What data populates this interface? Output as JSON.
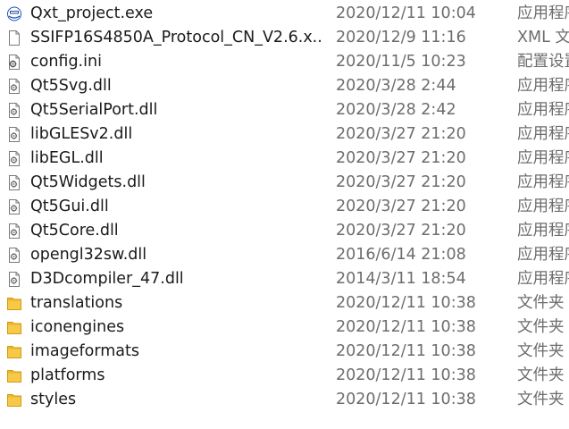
{
  "colors": {
    "text_primary": "#1a1a1a",
    "text_secondary": "#6d6d6d",
    "folder": "#f7c948",
    "hover": "#e5f3ff",
    "exe_brand": "#1f4fb5"
  },
  "files": [
    {
      "name": "Qxt_project.exe",
      "date": "2020/12/11 10:04",
      "type": "应用程序",
      "icon": "exe-icon"
    },
    {
      "name": "SSIFP16S4850A_Protocol_CN_V2.6.x...",
      "date": "2020/12/9 11:16",
      "type": "XML 文档",
      "icon": "xml-file-icon"
    },
    {
      "name": "config.ini",
      "date": "2020/11/5 10:23",
      "type": "配置设置",
      "icon": "ini-file-icon"
    },
    {
      "name": "Qt5Svg.dll",
      "date": "2020/3/28 2:44",
      "type": "应用程序扩展",
      "icon": "dll-file-icon"
    },
    {
      "name": "Qt5SerialPort.dll",
      "date": "2020/3/28 2:42",
      "type": "应用程序扩展",
      "icon": "dll-file-icon"
    },
    {
      "name": "libGLESv2.dll",
      "date": "2020/3/27 21:20",
      "type": "应用程序扩展",
      "icon": "dll-file-icon"
    },
    {
      "name": "libEGL.dll",
      "date": "2020/3/27 21:20",
      "type": "应用程序扩展",
      "icon": "dll-file-icon"
    },
    {
      "name": "Qt5Widgets.dll",
      "date": "2020/3/27 21:20",
      "type": "应用程序扩展",
      "icon": "dll-file-icon"
    },
    {
      "name": "Qt5Gui.dll",
      "date": "2020/3/27 21:20",
      "type": "应用程序扩展",
      "icon": "dll-file-icon"
    },
    {
      "name": "Qt5Core.dll",
      "date": "2020/3/27 21:20",
      "type": "应用程序扩展",
      "icon": "dll-file-icon"
    },
    {
      "name": "opengl32sw.dll",
      "date": "2016/6/14 21:08",
      "type": "应用程序扩展",
      "icon": "dll-file-icon"
    },
    {
      "name": "D3Dcompiler_47.dll",
      "date": "2014/3/11 18:54",
      "type": "应用程序扩展",
      "icon": "dll-file-icon"
    },
    {
      "name": "translations",
      "date": "2020/12/11 10:38",
      "type": "文件夹",
      "icon": "folder-icon"
    },
    {
      "name": "iconengines",
      "date": "2020/12/11 10:38",
      "type": "文件夹",
      "icon": "folder-icon"
    },
    {
      "name": "imageformats",
      "date": "2020/12/11 10:38",
      "type": "文件夹",
      "icon": "folder-icon"
    },
    {
      "name": "platforms",
      "date": "2020/12/11 10:38",
      "type": "文件夹",
      "icon": "folder-icon"
    },
    {
      "name": "styles",
      "date": "2020/12/11 10:38",
      "type": "文件夹",
      "icon": "folder-icon"
    }
  ]
}
